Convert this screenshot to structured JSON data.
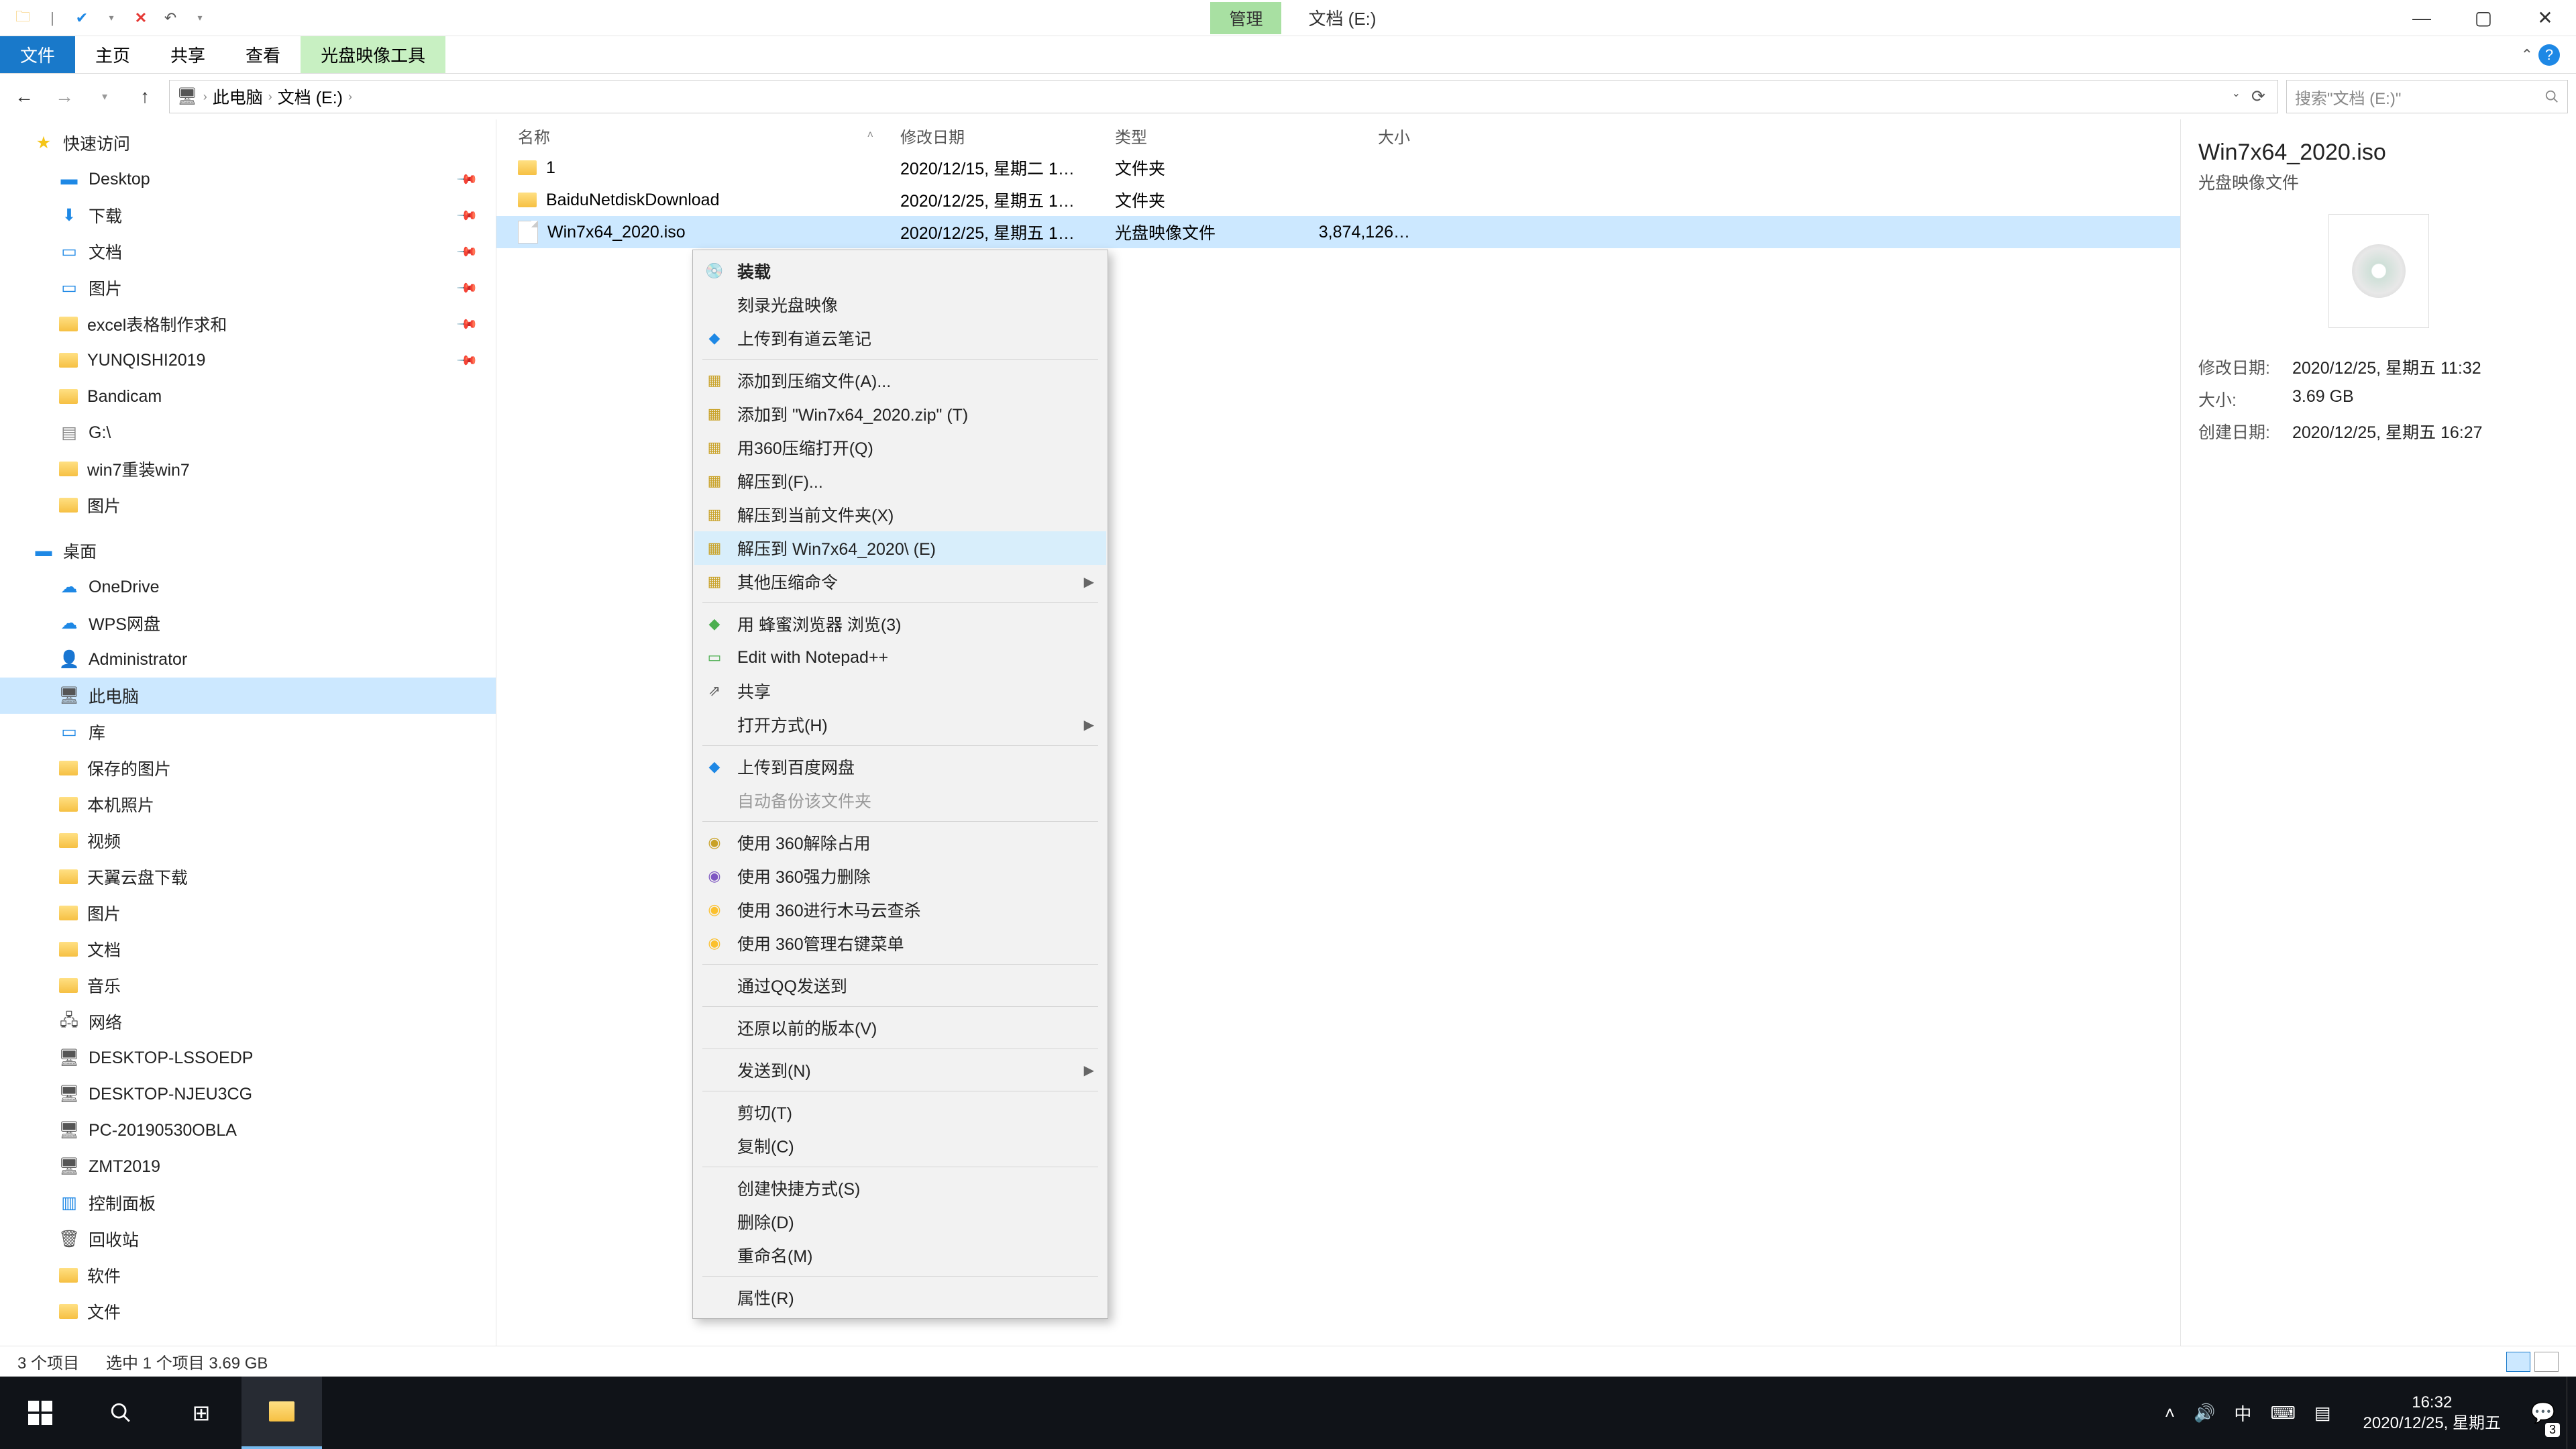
{
  "titlebar": {
    "context_tab": "管理",
    "title": "文档 (E:)"
  },
  "ribbon": {
    "file": "文件",
    "home": "主页",
    "share": "共享",
    "view": "查看",
    "ctx_tool": "光盘映像工具"
  },
  "breadcrumb": {
    "root": "此电脑",
    "loc": "文档 (E:)"
  },
  "search": {
    "placeholder": "搜索\"文档 (E:)\""
  },
  "nav": {
    "quick": "快速访问",
    "items_quick": [
      "Desktop",
      "下载",
      "文档",
      "图片",
      "excel表格制作求和",
      "YUNQISHI2019",
      "Bandicam",
      "G:\\",
      "win7重装win7",
      "图片"
    ],
    "desktop": "桌面",
    "items_desk": [
      "OneDrive",
      "WPS网盘",
      "Administrator",
      "此电脑",
      "库"
    ],
    "lib_items": [
      "保存的图片",
      "本机照片",
      "视频",
      "天翼云盘下载",
      "图片",
      "文档",
      "音乐"
    ],
    "network": "网络",
    "net_items": [
      "DESKTOP-LSSOEDP",
      "DESKTOP-NJEU3CG",
      "PC-20190530OBLA",
      "ZMT2019"
    ],
    "cpanel": "控制面板",
    "recycle": "回收站",
    "soft": "软件",
    "docs": "文件"
  },
  "columns": {
    "name": "名称",
    "date": "修改日期",
    "type": "类型",
    "size": "大小"
  },
  "rows": [
    {
      "name": "1",
      "date": "2020/12/15, 星期二 1…",
      "type": "文件夹",
      "size": ""
    },
    {
      "name": "BaiduNetdiskDownload",
      "date": "2020/12/25, 星期五 1…",
      "type": "文件夹",
      "size": ""
    },
    {
      "name": "Win7x64_2020.iso",
      "date": "2020/12/25, 星期五 1…",
      "type": "光盘映像文件",
      "size": "3,874,126…"
    }
  ],
  "details": {
    "title": "Win7x64_2020.iso",
    "subtitle": "光盘映像文件",
    "mod_label": "修改日期:",
    "mod_val": "2020/12/25, 星期五 11:32",
    "size_label": "大小:",
    "size_val": "3.69 GB",
    "create_label": "创建日期:",
    "create_val": "2020/12/25, 星期五 16:27"
  },
  "status": {
    "count": "3 个项目",
    "sel": "选中 1 个项目  3.69 GB"
  },
  "context": {
    "mount": "装载",
    "burn": "刻录光盘映像",
    "youdao": "上传到有道云笔记",
    "addarc": "添加到压缩文件(A)...",
    "addzip": "添加到 \"Win7x64_2020.zip\" (T)",
    "open360": "用360压缩打开(Q)",
    "extractf": "解压到(F)...",
    "extracthere": "解压到当前文件夹(X)",
    "extractnamed": "解压到 Win7x64_2020\\ (E)",
    "othercomp": "其他压缩命令",
    "browser": "用 蜂蜜浏览器 浏览(3)",
    "notepad": "Edit with Notepad++",
    "share": "共享",
    "openwith": "打开方式(H)",
    "baidu": "上传到百度网盘",
    "autobackup": "自动备份该文件夹",
    "unlock360": "使用 360解除占用",
    "force360": "使用 360强力删除",
    "trojan360": "使用 360进行木马云查杀",
    "menu360": "使用 360管理右键菜单",
    "qq": "通过QQ发送到",
    "restore": "还原以前的版本(V)",
    "sendto": "发送到(N)",
    "cut": "剪切(T)",
    "copy": "复制(C)",
    "shortcut": "创建快捷方式(S)",
    "delete": "删除(D)",
    "rename": "重命名(M)",
    "props": "属性(R)"
  },
  "taskbar": {
    "time": "16:32",
    "date": "2020/12/25, 星期五",
    "ime": "中",
    "badge": "3"
  }
}
